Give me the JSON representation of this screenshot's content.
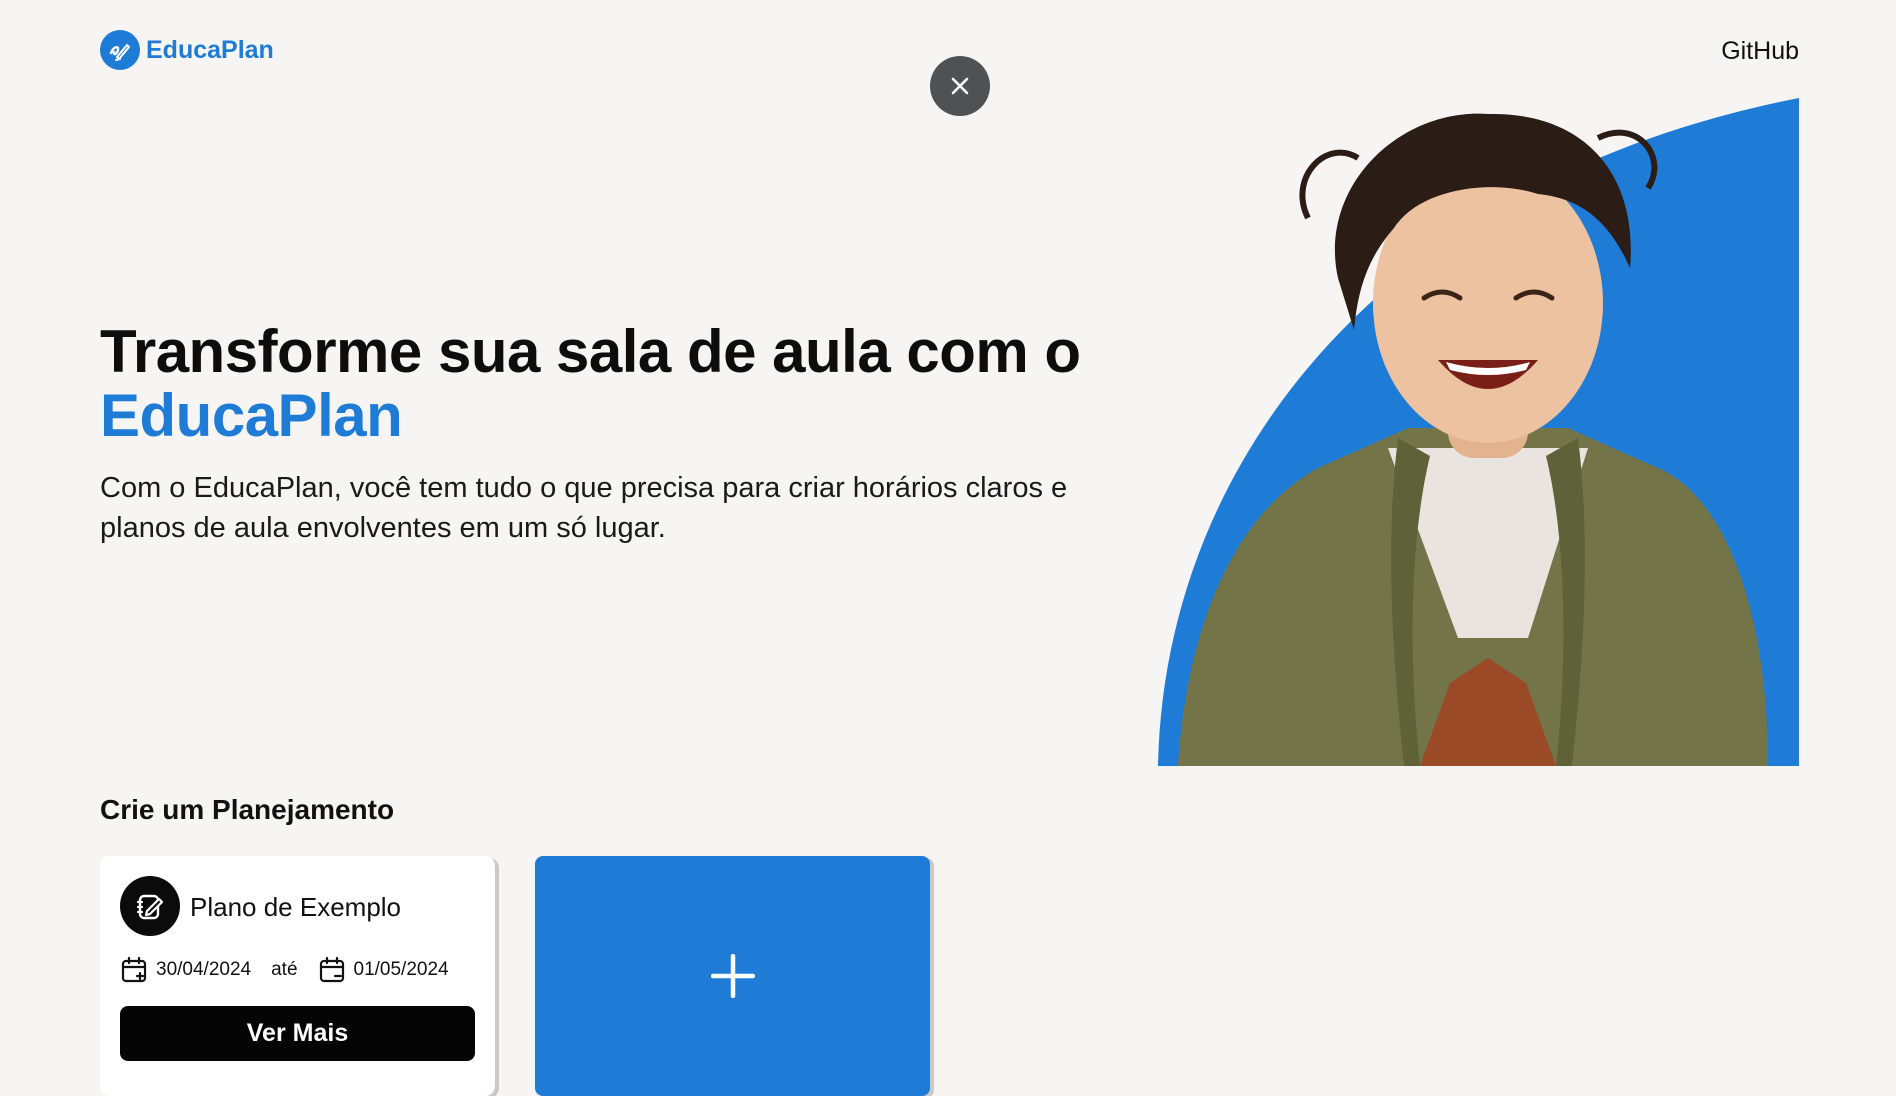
{
  "header": {
    "logo_text": "EducaPlan",
    "github_link": "GitHub"
  },
  "hero": {
    "title_line1": "Transforme sua sala de aula com o",
    "title_brand": "EducaPlan",
    "description": "Com o EducaPlan, você tem tudo o que precisa para criar horários claros e planos de aula envolventes em um só lugar."
  },
  "section": {
    "title": "Crie um Planejamento"
  },
  "plan_card": {
    "name": "Plano de Exemplo",
    "start_date": "30/04/2024",
    "separator": "até",
    "end_date": "01/05/2024",
    "view_button": "Ver Mais"
  },
  "colors": {
    "accent": "#1e7bd6",
    "background": "#f6f5f4",
    "dark_button": "#050505",
    "close_button": "#4f5254"
  },
  "icons": {
    "logo": "educaplan-logo-icon",
    "close": "close-icon",
    "plan": "edit-note-icon",
    "calendar_start": "calendar-plus-icon",
    "calendar_end": "calendar-minus-icon",
    "add": "plus-icon"
  }
}
